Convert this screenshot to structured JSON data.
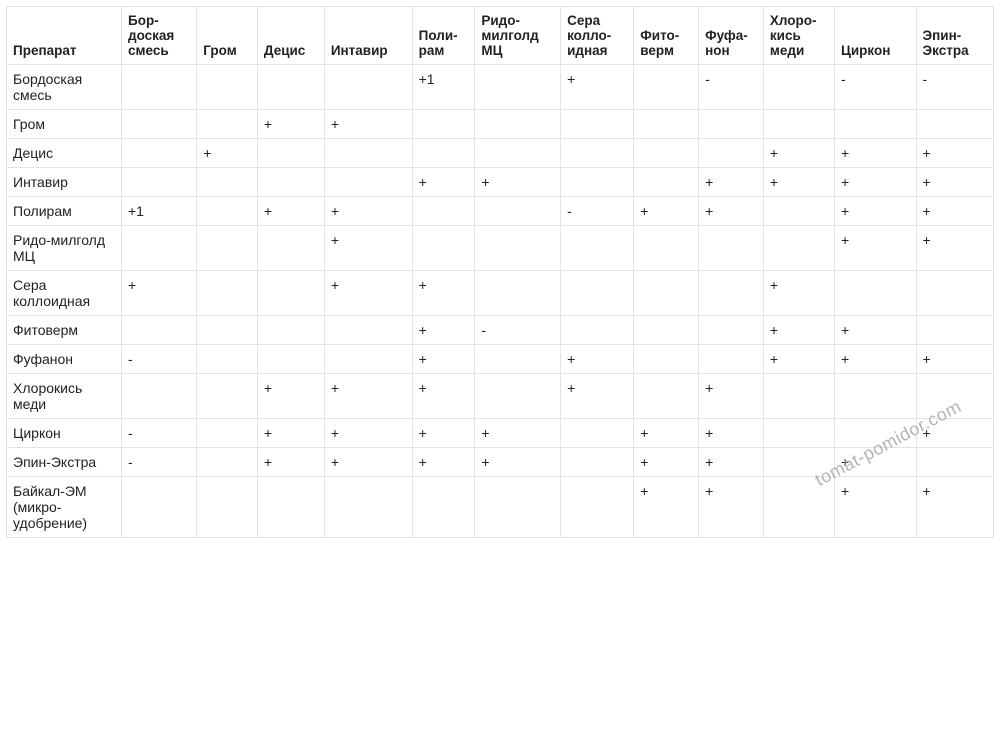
{
  "watermark": "tomat-pomidor.com",
  "columns": [
    "Препарат",
    "Бор-доская смесь",
    "Гром",
    "Децис",
    "Интавир",
    "Поли-рам",
    "Ридо-милголд МЦ",
    "Сера колло-идная",
    "Фито-верм",
    "Фуфа-нон",
    "Хлоро-кись меди",
    "Циркон",
    "Эпин-Экстра"
  ],
  "rows": [
    {
      "name": "Бордоская смесь",
      "cells": [
        "",
        "",
        "",
        "",
        "+1",
        "",
        "+",
        "",
        "-",
        "",
        "-",
        "-"
      ]
    },
    {
      "name": "Гром",
      "cells": [
        "",
        "",
        "+",
        "+",
        "",
        "",
        "",
        "",
        "",
        "",
        "",
        ""
      ]
    },
    {
      "name": "Децис",
      "cells": [
        "",
        "+",
        "",
        "",
        "",
        "",
        "",
        "",
        "",
        "+",
        "+",
        "+"
      ]
    },
    {
      "name": "Интавир",
      "cells": [
        "",
        "",
        "",
        "",
        "+",
        "+",
        "",
        "",
        "+",
        "+",
        "+",
        "+"
      ]
    },
    {
      "name": "Полирам",
      "cells": [
        "+1",
        "",
        "+",
        "+",
        "",
        "",
        "-",
        "+",
        "+",
        "",
        "+",
        "+"
      ]
    },
    {
      "name": "Ридо-милголд МЦ",
      "cells": [
        "",
        "",
        "",
        "+",
        "",
        "",
        "",
        "",
        "",
        "",
        "+",
        "+"
      ]
    },
    {
      "name": "Сера коллоидная",
      "cells": [
        "+",
        "",
        "",
        "+",
        "+",
        "",
        "",
        "",
        "",
        "+",
        "",
        ""
      ]
    },
    {
      "name": "Фитоверм",
      "cells": [
        "",
        "",
        "",
        "",
        "+",
        "-",
        "",
        "",
        "",
        "+",
        "+",
        ""
      ]
    },
    {
      "name": "Фуфанон",
      "cells": [
        "-",
        "",
        "",
        "",
        "+",
        "",
        "+",
        "",
        "",
        "+",
        "+",
        "+"
      ]
    },
    {
      "name": "Хлорокись меди",
      "cells": [
        "",
        "",
        "+",
        "+",
        "+",
        "",
        "+",
        "",
        "+",
        "",
        "",
        ""
      ]
    },
    {
      "name": "Циркон",
      "cells": [
        "-",
        "",
        "+",
        "+",
        "+",
        "+",
        "",
        "+",
        "+",
        "",
        "",
        "+"
      ]
    },
    {
      "name": "Эпин-Экстра",
      "cells": [
        "-",
        "",
        "+",
        "+",
        "+",
        "+",
        "",
        "+",
        "+",
        "",
        "+",
        ""
      ]
    },
    {
      "name": "Байкал-ЭМ (микро-удобрение)",
      "cells": [
        "",
        "",
        "",
        "",
        "",
        "",
        "",
        "+",
        "+",
        "",
        "+",
        "+"
      ]
    }
  ]
}
